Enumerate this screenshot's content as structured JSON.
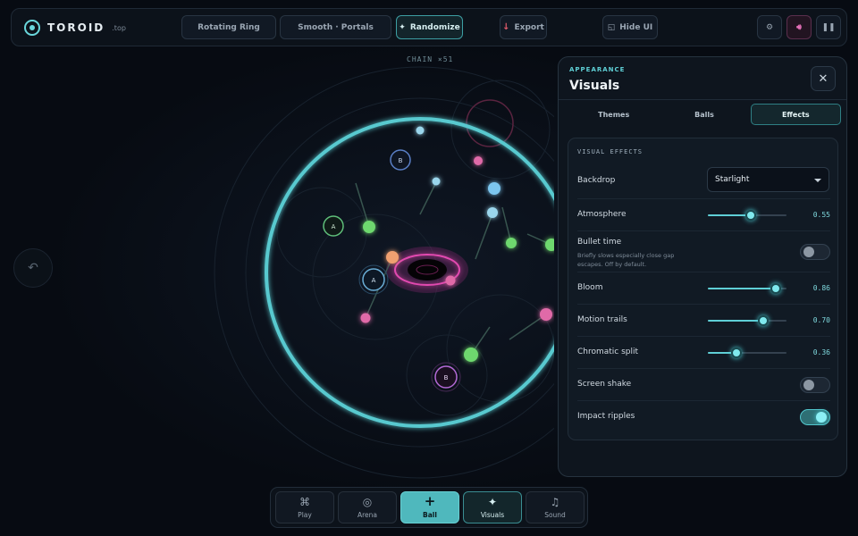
{
  "brand": {
    "name": "TOROID",
    "tld": ".top"
  },
  "toolbar": {
    "preset_1": "Rotating Ring",
    "preset_2": "Smooth · Portals",
    "randomize": "Randomize",
    "export": "Export",
    "hide_ui": "Hide UI"
  },
  "arena": {
    "chain_label": "CHAIN ×51",
    "markers": [
      "A",
      "B",
      "A",
      "B"
    ]
  },
  "panel": {
    "kicker": "APPEARANCE",
    "title": "Visuals",
    "tabs": [
      "Themes",
      "Balls",
      "Effects"
    ],
    "active_tab": "Effects",
    "section_heading": "VISUAL EFFECTS",
    "backdrop": {
      "label": "Backdrop",
      "value": "Starlight"
    },
    "atmosphere": {
      "label": "Atmosphere",
      "value": "0.55",
      "level": 0.55
    },
    "bullet_time": {
      "label": "Bullet time",
      "description": "Briefly slows especially close gap escapes. Off by default.",
      "on": false
    },
    "bloom": {
      "label": "Bloom",
      "value": "0.86",
      "level": 0.86
    },
    "motion_trails": {
      "label": "Motion trails",
      "value": "0.70",
      "level": 0.7
    },
    "chromatic_split": {
      "label": "Chromatic split",
      "value": "0.36",
      "level": 0.36
    },
    "screen_shake": {
      "label": "Screen shake",
      "on": false
    },
    "impact_ripples": {
      "label": "Impact ripples",
      "on": true
    }
  },
  "dock": {
    "play": "Play",
    "arena": "Arena",
    "ball": "Ball",
    "visuals": "Visuals",
    "sound": "Sound"
  },
  "colors": {
    "accent": "#5fcfd6",
    "ring": "#58c9cf",
    "pink": "#e06aa8",
    "green": "#6ed86e"
  }
}
